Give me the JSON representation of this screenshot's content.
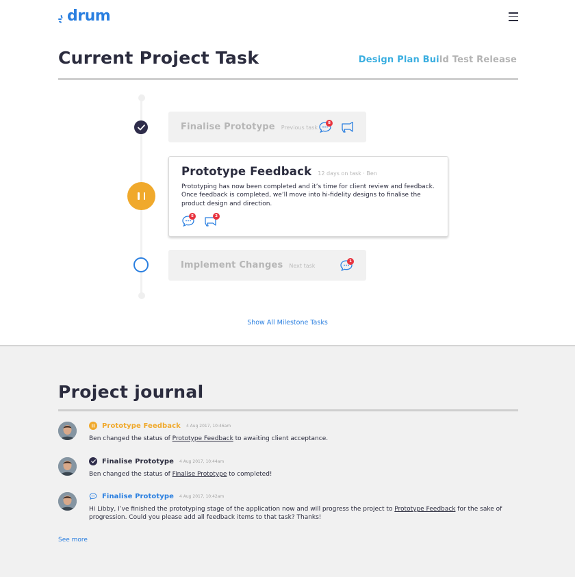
{
  "brand": {
    "logo_text": "drum",
    "color": "#2a7fe0"
  },
  "header": {
    "menu_icon": "hamburger-menu-icon"
  },
  "project": {
    "title": "Current Project Task",
    "phases": {
      "done_text": "Design Plan Bui",
      "pending_text": "ld Test Release"
    }
  },
  "timeline": {
    "previous": {
      "title": "Finalise Prototype",
      "subtitle": "Previous task",
      "comment_count": "8"
    },
    "current": {
      "title": "Prototype Feedback",
      "meta": "12 days on task · Ben",
      "description": "Prototyping has now been completed and it’s time for client review and feedback. Once feedback is completed, we’ll move into hi-fidelity designs to finalise the product design and direction.",
      "comment_count": "5",
      "announce_count": "2"
    },
    "next": {
      "title": "Implement Changes",
      "subtitle": "Next task",
      "comment_count": "1"
    },
    "show_all": "Show All Milestone Tasks"
  },
  "journal": {
    "title": "Project journal",
    "entries": [
      {
        "title": "Prototype Feedback",
        "time": "4 Aug 2017, 10:46am",
        "text_before": "Ben changed the status of ",
        "link": "Prototype Feedback",
        "text_after": " to awaiting client acceptance.",
        "color": "#f0a92c"
      },
      {
        "title": "Finalise Prototype",
        "time": "4 Aug 2017, 10:44am",
        "text_before": "Ben changed the status of ",
        "link": "Finalise Prototype",
        "text_after": " to completed!",
        "color": "#2b2c3e"
      },
      {
        "title": "Finalise Prototype",
        "time": "4 Aug 2017, 10:42am",
        "text_before": "Hi Libby, I’ve finished the prototyping stage of the application now and will progress the project to ",
        "link": "Prototype Feedback",
        "text_after": " for the sake of progression. Could you please add all feedback items to that task? Thanks!",
        "color": "#2a7fe0"
      }
    ],
    "see_more": "See more"
  },
  "colors": {
    "accent_blue": "#2a7fe0",
    "phase_blue": "#3aaee0",
    "status_orange": "#f0a92c",
    "dark_navy": "#2b2c3e",
    "badge_red": "#e8343f"
  }
}
